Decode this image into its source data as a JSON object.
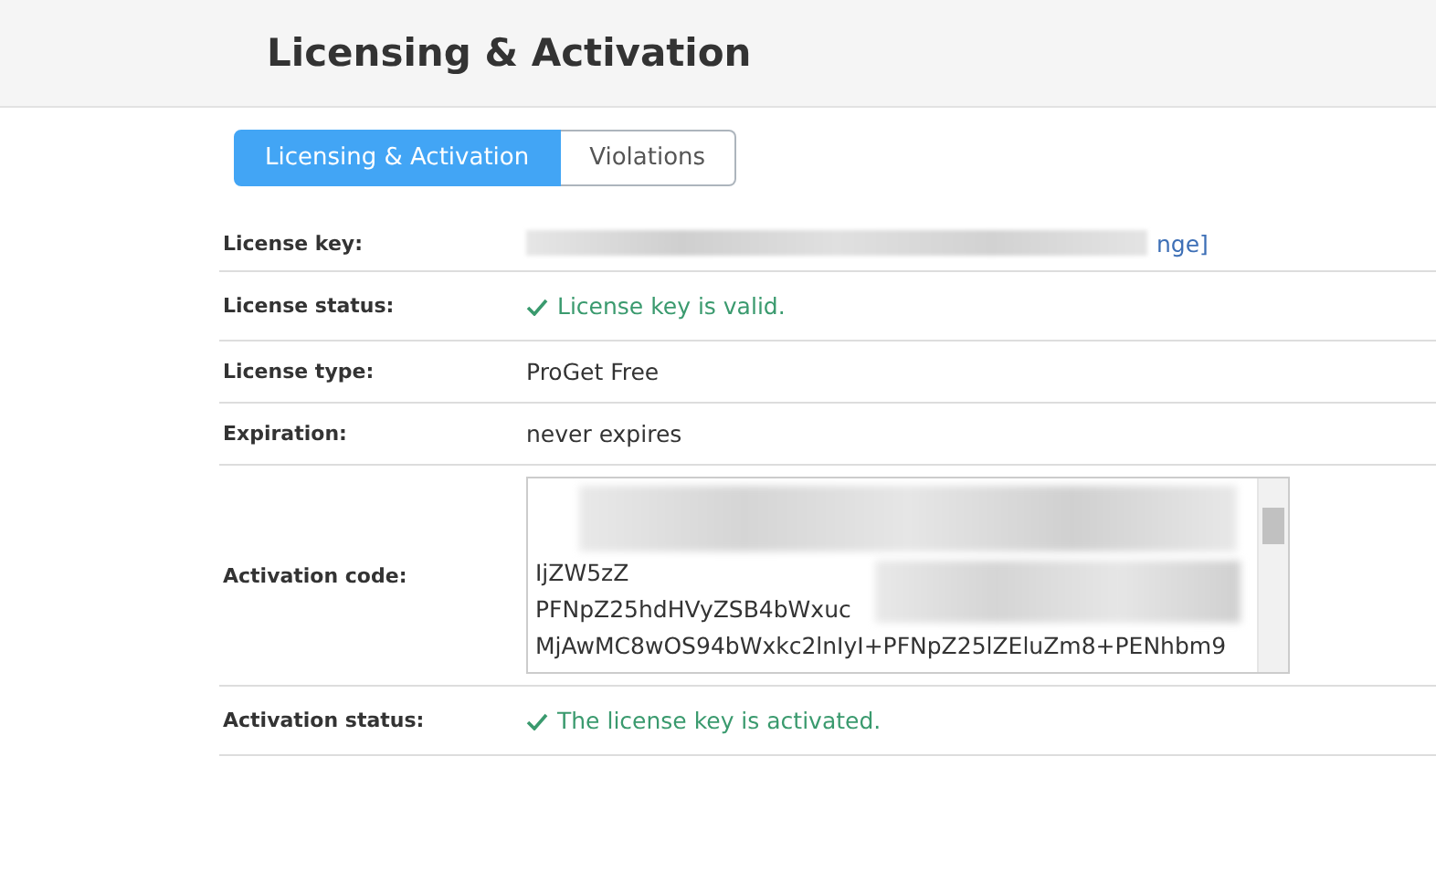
{
  "header": {
    "title": "Licensing & Activation"
  },
  "tabs": [
    {
      "label": "Licensing & Activation",
      "selected": true
    },
    {
      "label": "Violations",
      "selected": false
    }
  ],
  "rows": [
    {
      "label": "License key:",
      "kind": "key",
      "link": "nge]"
    },
    {
      "label": "License status:",
      "kind": "ok",
      "value": "License key is valid."
    },
    {
      "label": "License type:",
      "kind": "text",
      "value": "ProGet Free"
    },
    {
      "label": "Expiration:",
      "kind": "text",
      "value": "never expires"
    },
    {
      "label": "Activation code:",
      "kind": "code",
      "lines": [
        "IjZW5zZ",
        "PFNpZ25hdHVyZSB4bWxuc",
        "MjAwMC8wOS94bWxkc2lnIyI+PFNpZ25lZEluZm8+PENhbm9"
      ]
    },
    {
      "label": "Activation status:",
      "kind": "ok",
      "value": "The license key is activated."
    }
  ]
}
